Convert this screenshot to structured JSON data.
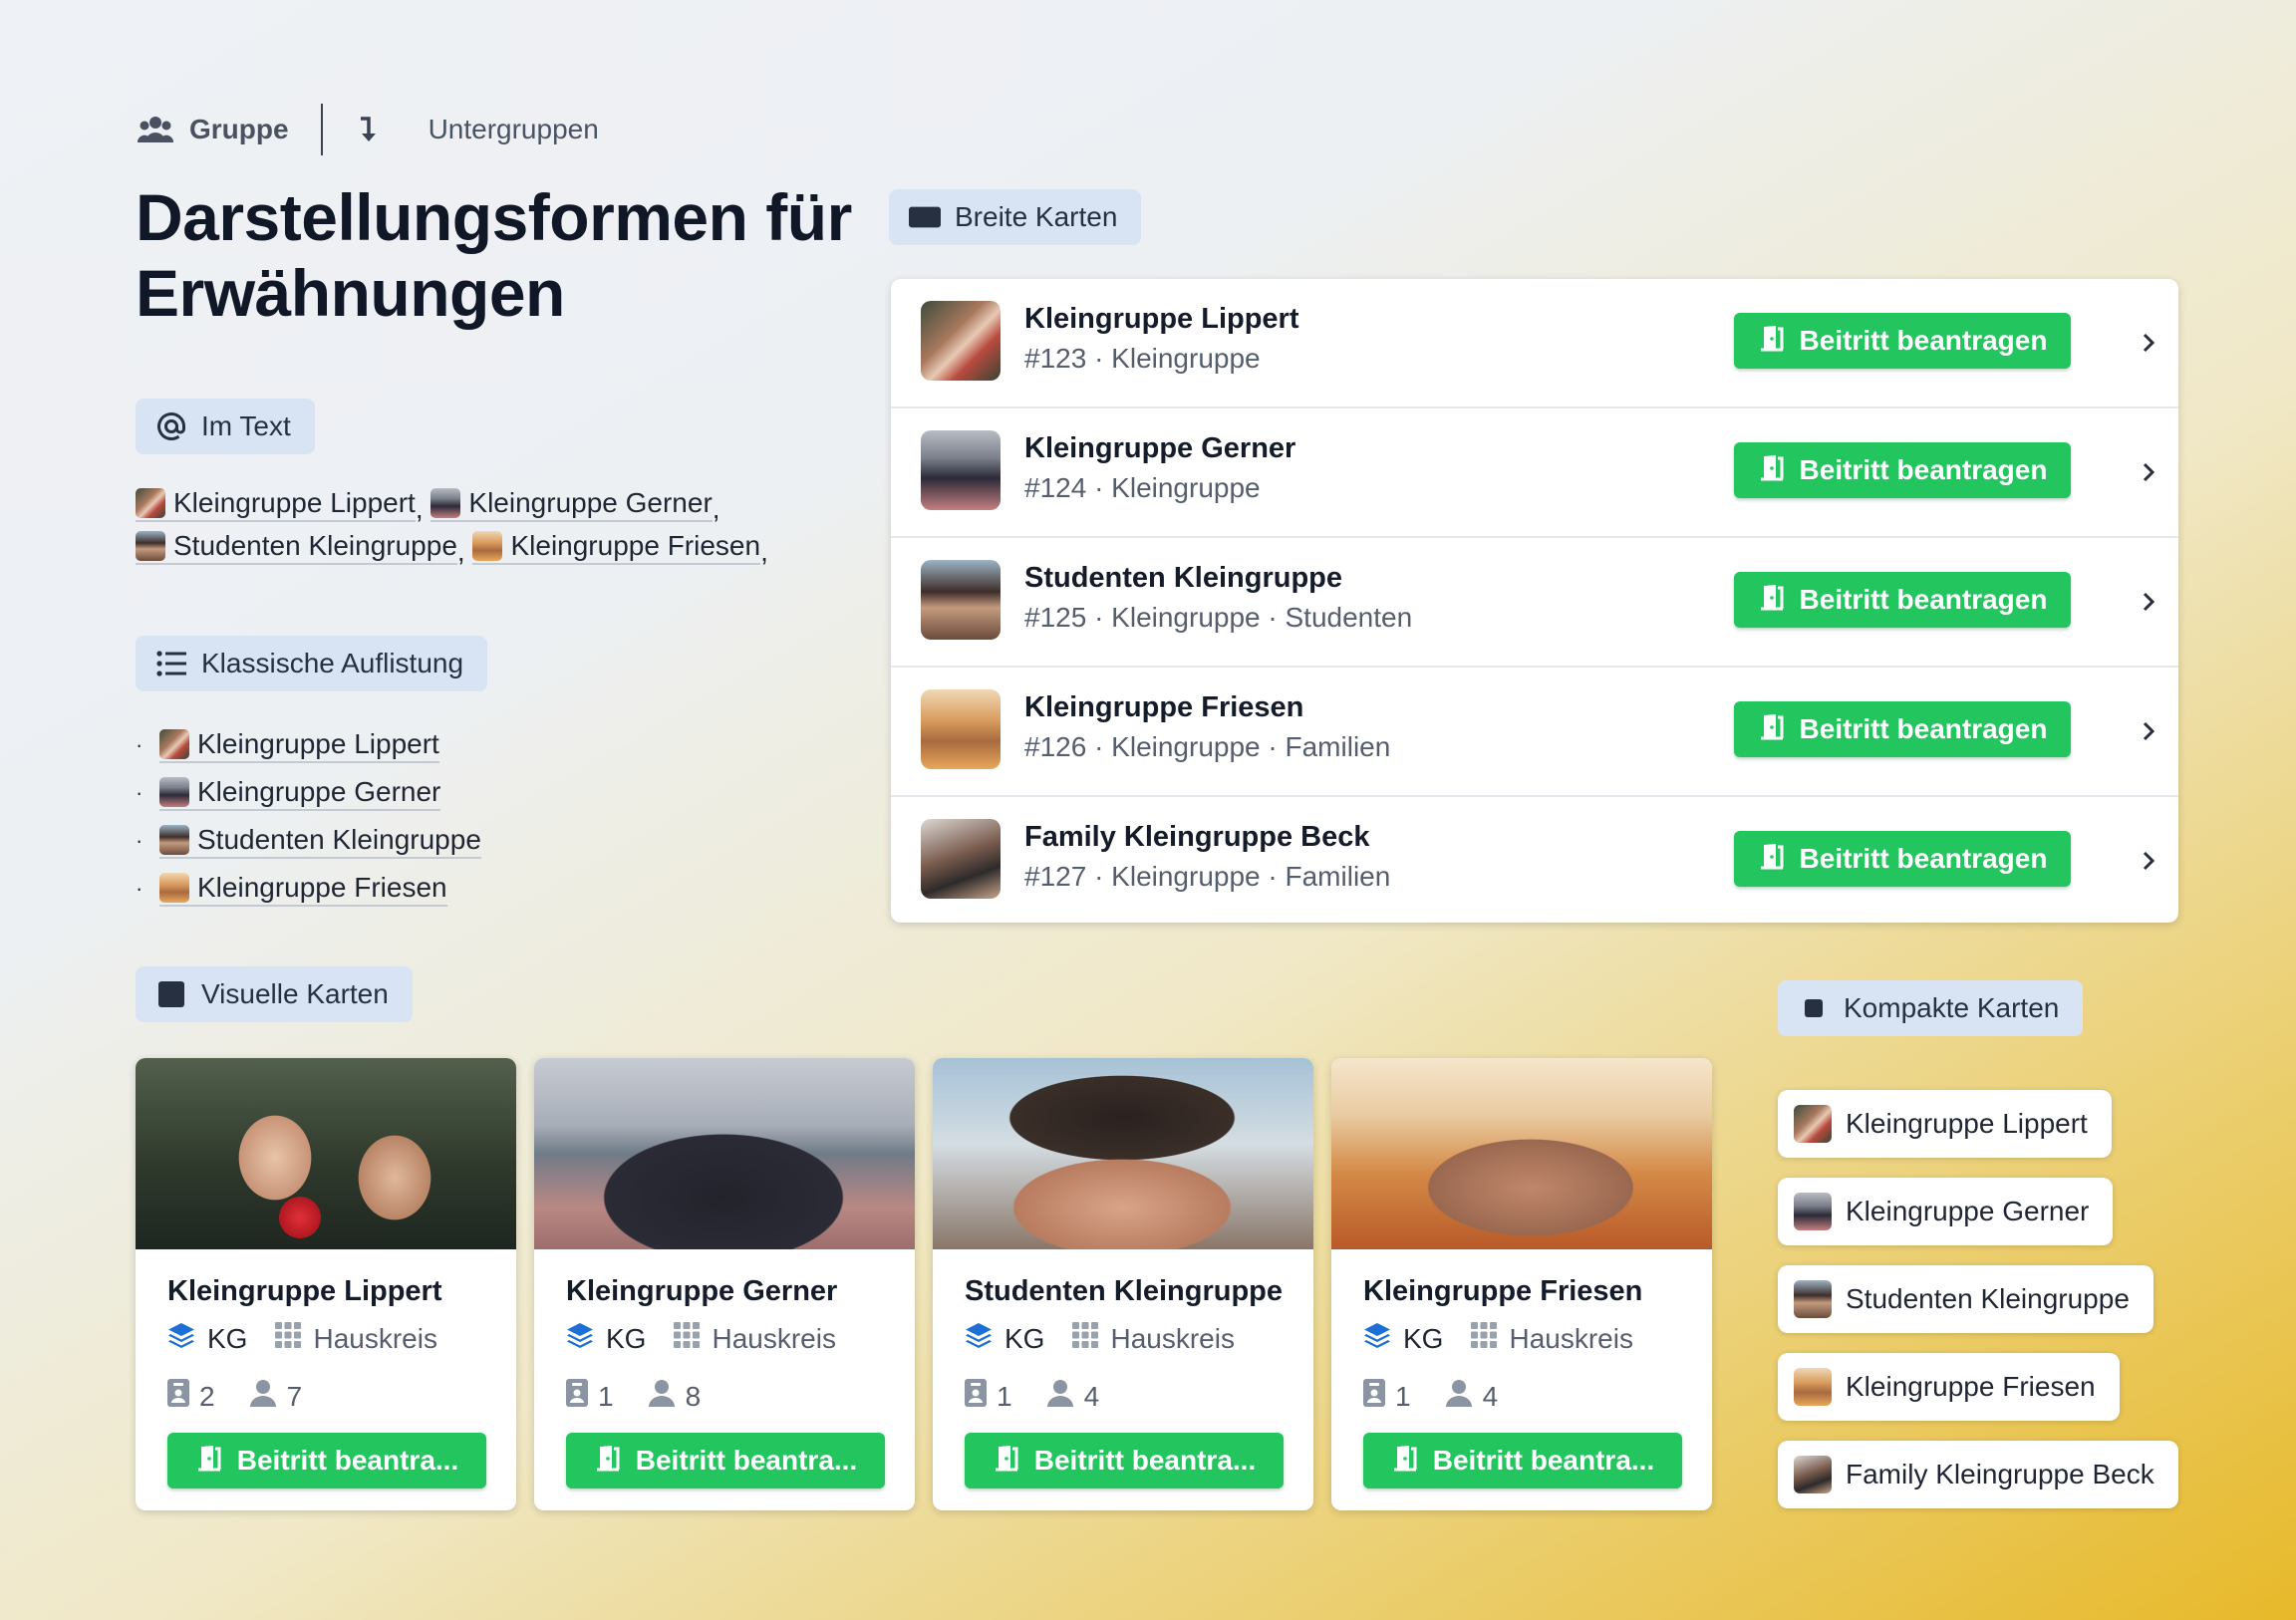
{
  "breadcrumb": {
    "group": "Gruppe",
    "subgroups": "Untergruppen"
  },
  "page_title": "Darstellungsformen für Erwähnungen",
  "sections": {
    "inline": "Im Text",
    "list": "Klassische Auflistung",
    "wide": "Breite Karten",
    "visual": "Visuelle Karten",
    "compact": "Kompakte Karten"
  },
  "inline_mentions": [
    {
      "name": "Kleingruppe Lippert",
      "sep": ","
    },
    {
      "name": "Kleingruppe Gerner",
      "sep": ","
    },
    {
      "name": "Studenten Kleingruppe",
      "sep": ","
    },
    {
      "name": "Kleingruppe Friesen",
      "sep": ","
    }
  ],
  "list_items": [
    "Kleingruppe Lippert",
    "Kleingruppe Gerner",
    "Studenten Kleingruppe",
    "Kleingruppe Friesen"
  ],
  "list_bullet": "·",
  "wide_cards": [
    {
      "name": "Kleingruppe Lippert",
      "meta": "#123 · Kleingruppe",
      "button": "Beitritt beantragen"
    },
    {
      "name": "Kleingruppe Gerner",
      "meta": "#124 · Kleingruppe",
      "button": "Beitritt beantragen"
    },
    {
      "name": "Studenten Kleingruppe",
      "meta": "#125 · Kleingruppe · Studenten",
      "button": "Beitritt beantragen"
    },
    {
      "name": "Kleingruppe Friesen",
      "meta": "#126 · Kleingruppe · Familien",
      "button": "Beitritt beantragen"
    },
    {
      "name": "Family Kleingruppe Beck",
      "meta": "#127 · Kleingruppe · Familien",
      "button": "Beitritt beantragen"
    }
  ],
  "visual_cards": [
    {
      "name": "Kleingruppe Lippert",
      "tag1": "KG",
      "tag2": "Hauskreis",
      "stat1": "2",
      "stat2": "7",
      "button": "Beitritt beantra..."
    },
    {
      "name": "Kleingruppe Gerner",
      "tag1": "KG",
      "tag2": "Hauskreis",
      "stat1": "1",
      "stat2": "8",
      "button": "Beitritt beantra..."
    },
    {
      "name": "Studenten Kleingruppe",
      "tag1": "KG",
      "tag2": "Hauskreis",
      "stat1": "1",
      "stat2": "4",
      "button": "Beitritt beantra..."
    },
    {
      "name": "Kleingruppe Friesen",
      "tag1": "KG",
      "tag2": "Hauskreis",
      "stat1": "1",
      "stat2": "4",
      "button": "Beitritt beantra..."
    }
  ],
  "compact_cards": [
    "Kleingruppe Lippert",
    "Kleingruppe Gerner",
    "Studenten Kleingruppe",
    "Kleingruppe Friesen",
    "Family Kleingruppe Beck"
  ],
  "colors": {
    "accent_green": "#22c55e",
    "chip_bg": "#d8e4f4",
    "title": "#101828",
    "gradient_end": "#e7b92a"
  },
  "icons": {
    "group": "users-icon",
    "subgroups": "arrow-turn-down-icon",
    "inline": "at-icon",
    "list": "list-icon",
    "wide": "wide-rectangle-icon",
    "visual": "square-icon",
    "compact": "small-square-icon",
    "join": "door-open-icon",
    "chevron": "chevron-right-icon",
    "tag1": "layers-icon",
    "tag2": "grid-icon",
    "stat1": "badge-icon",
    "stat2": "user-icon"
  }
}
